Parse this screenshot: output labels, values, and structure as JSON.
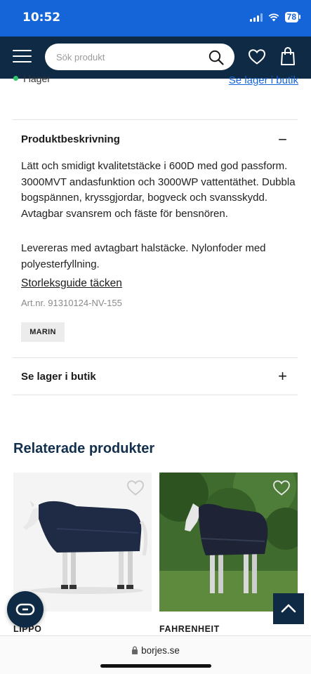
{
  "status_bar": {
    "time": "10:52",
    "battery": "78"
  },
  "header": {
    "search": {
      "placeholder": "Sök produkt"
    },
    "icons": {
      "menu": "hamburger-icon",
      "search": "search-icon",
      "wishlist": "heart-icon",
      "cart": "shopping-bag-icon"
    }
  },
  "stock": {
    "status": "I lager",
    "store_link": "Se lager i butik",
    "dot_color": "#2ec46b"
  },
  "description": {
    "title": "Produktbeskrivning",
    "toggle": "−",
    "paragraphs": [
      "Lätt och smidigt kvalitetstäcke i 600D med god passform. 3000MVT andasfunktion och 3000WP vattentäthet. Dubbla bogspännen, kryssgjordar, bogveck och svansskydd. Avtagbar svansrem och fäste för bensnören.",
      "Levereras med avtagbart halstäcke. Nylonfoder med polyesterfyllning."
    ],
    "size_guide_link": "Storleksguide täcken",
    "article_number": "Art.nr. 91310124-NV-155",
    "color_chip": "MARIN"
  },
  "store_stock": {
    "title": "Se lager i butik",
    "toggle": "+"
  },
  "related": {
    "title": "Relaterade produkter",
    "products": [
      {
        "name": "LIPPO"
      },
      {
        "name": "FAHRENHEIT"
      }
    ]
  },
  "browser": {
    "url": "borjes.se"
  },
  "colors": {
    "status_bar": "#1565d8",
    "header": "#0f2a45",
    "link": "#1565d8",
    "heading": "#12304e"
  }
}
